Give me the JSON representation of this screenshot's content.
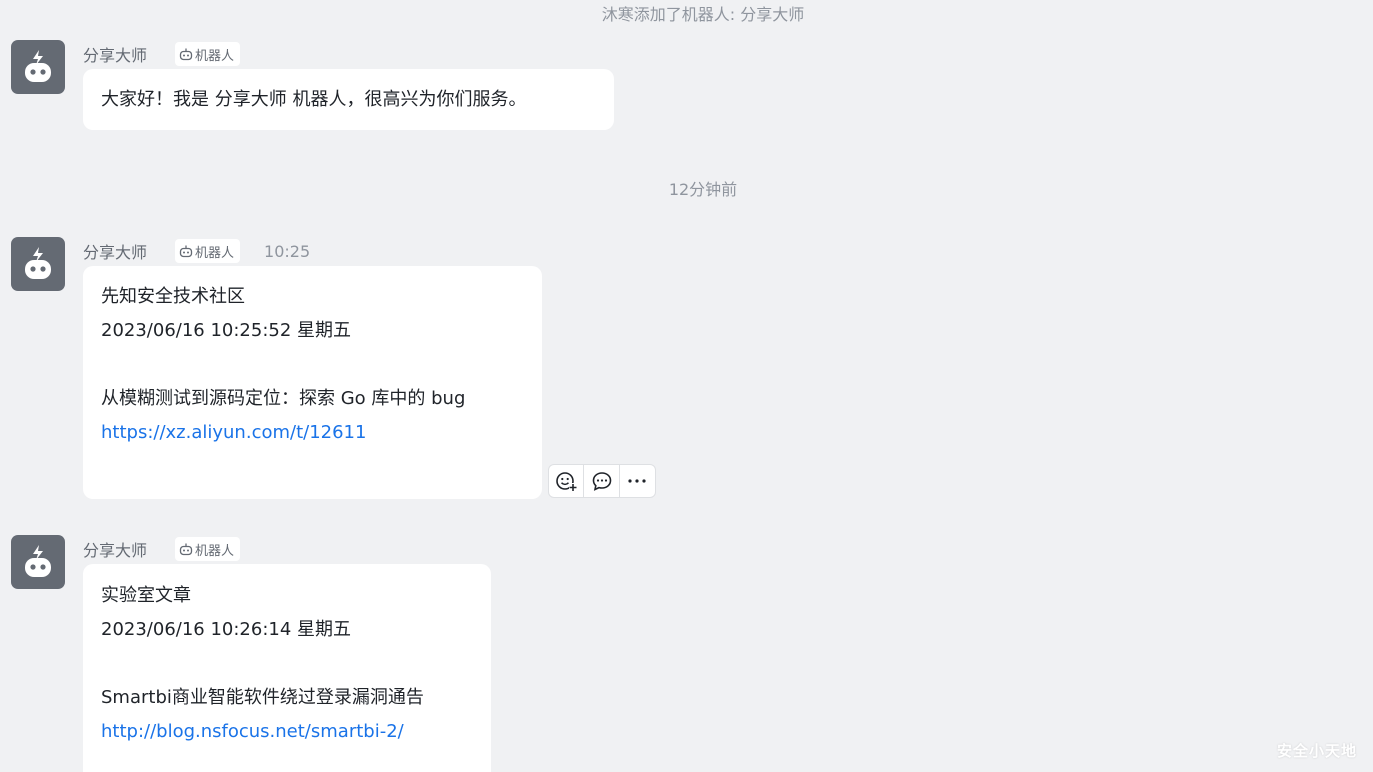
{
  "system_notice": "沐寒添加了机器人: 分享大师",
  "time_divider": "12分钟前",
  "colors": {
    "background": "#f0f1f3",
    "avatar_bg": "#646a73",
    "link": "#1a73e8",
    "bubble": "#ffffff"
  },
  "messages": [
    {
      "sender": "分享大师",
      "tag": "机器人",
      "time": "",
      "lines": [
        "大家好！我是 分享大师 机器人，很高兴为你们服务。"
      ]
    },
    {
      "sender": "分享大师",
      "tag": "机器人",
      "time": "10:25",
      "lines": [
        "先知安全技术社区",
        "2023/06/16 10:25:52 星期五",
        "",
        "从模糊测试到源码定位：探索 Go 库中的 bug"
      ],
      "link": "https://xz.aliyun.com/t/12611"
    },
    {
      "sender": "分享大师",
      "tag": "机器人",
      "time": "",
      "lines": [
        "实验室文章",
        "2023/06/16 10:26:14 星期五",
        "",
        "Smartbi商业智能软件绕过登录漏洞通告"
      ],
      "link": "http://blog.nsfocus.net/smartbi-2/"
    }
  ],
  "toolbar": {
    "icons": [
      "emoji-reaction-icon",
      "reply-icon",
      "more-icon"
    ]
  },
  "watermark": "安全小天地"
}
